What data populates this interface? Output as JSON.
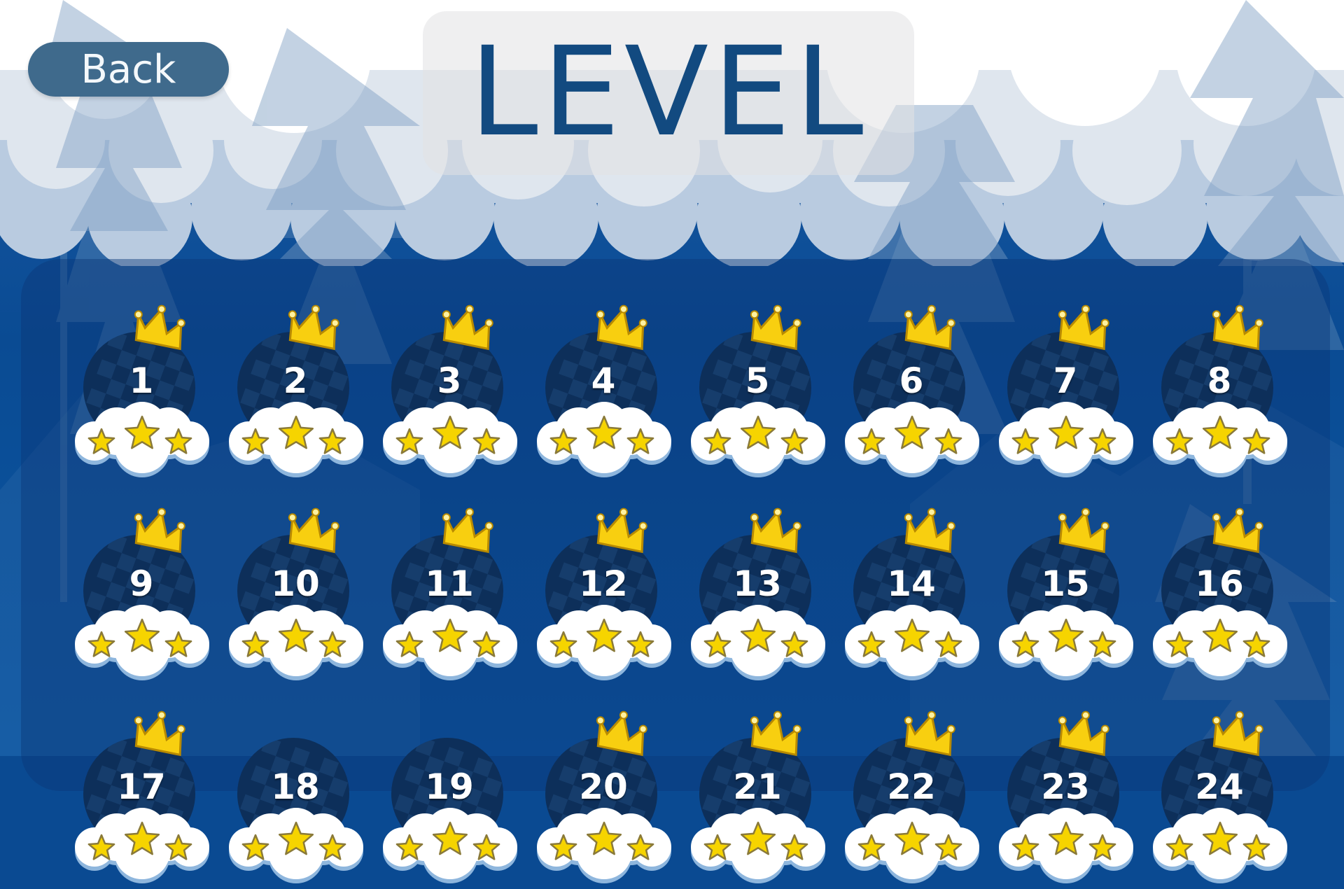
{
  "header": {
    "back_label": "Back",
    "title": "LEVEL"
  },
  "colors": {
    "title": "#124a80",
    "back_button": "#3f6a8c",
    "ball": "#0d2f5a",
    "star": "#f6d400",
    "crown": "#f8cf10"
  },
  "level_icons": {
    "crown": "crown-icon",
    "stars": "star-icon",
    "cloud": "cloud-icon"
  },
  "levels": [
    {
      "number": "1",
      "stars": 3,
      "crown": true
    },
    {
      "number": "2",
      "stars": 3,
      "crown": true
    },
    {
      "number": "3",
      "stars": 3,
      "crown": true
    },
    {
      "number": "4",
      "stars": 3,
      "crown": true
    },
    {
      "number": "5",
      "stars": 3,
      "crown": true
    },
    {
      "number": "6",
      "stars": 3,
      "crown": true
    },
    {
      "number": "7",
      "stars": 3,
      "crown": true
    },
    {
      "number": "8",
      "stars": 3,
      "crown": true
    },
    {
      "number": "9",
      "stars": 3,
      "crown": true
    },
    {
      "number": "10",
      "stars": 3,
      "crown": true
    },
    {
      "number": "11",
      "stars": 3,
      "crown": true
    },
    {
      "number": "12",
      "stars": 3,
      "crown": true
    },
    {
      "number": "13",
      "stars": 3,
      "crown": true
    },
    {
      "number": "14",
      "stars": 3,
      "crown": true
    },
    {
      "number": "15",
      "stars": 3,
      "crown": true
    },
    {
      "number": "16",
      "stars": 3,
      "crown": true
    },
    {
      "number": "17",
      "stars": 3,
      "crown": true
    },
    {
      "number": "18",
      "stars": 3,
      "crown": false
    },
    {
      "number": "19",
      "stars": 3,
      "crown": false
    },
    {
      "number": "20",
      "stars": 3,
      "crown": true
    },
    {
      "number": "21",
      "stars": 3,
      "crown": true
    },
    {
      "number": "22",
      "stars": 3,
      "crown": true
    },
    {
      "number": "23",
      "stars": 3,
      "crown": true
    },
    {
      "number": "24",
      "stars": 3,
      "crown": true
    }
  ]
}
